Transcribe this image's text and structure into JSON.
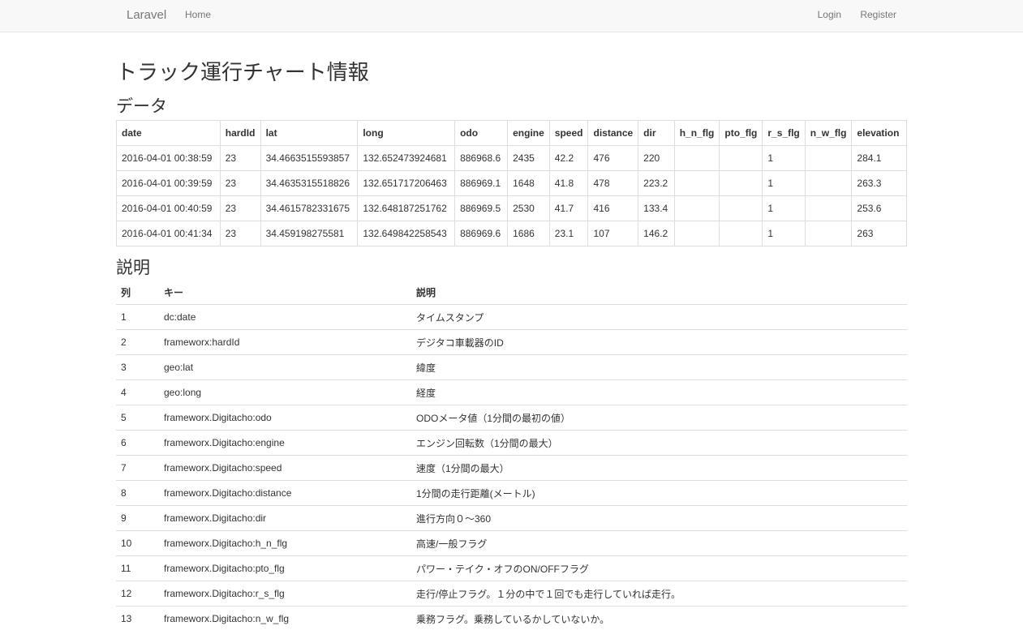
{
  "nav": {
    "brand": "Laravel",
    "home": "Home",
    "login": "Login",
    "register": "Register"
  },
  "page": {
    "title": "トラック運行チャート情報",
    "data_heading": "データ",
    "desc_heading": "説明"
  },
  "data_table": {
    "columns": [
      "date",
      "hardId",
      "lat",
      "long",
      "odo",
      "engine",
      "speed",
      "distance",
      "dir",
      "h_n_flg",
      "pto_flg",
      "r_s_flg",
      "n_w_flg",
      "elevation"
    ],
    "rows": [
      [
        "2016-04-01 00:38:59",
        "23",
        "34.4663515593857",
        "132.652473924681",
        "886968.6",
        "2435",
        "42.2",
        "476",
        "220",
        "",
        "",
        "1",
        "",
        "284.1"
      ],
      [
        "2016-04-01 00:39:59",
        "23",
        "34.4635315518826",
        "132.651717206463",
        "886969.1",
        "1648",
        "41.8",
        "478",
        "223.2",
        "",
        "",
        "1",
        "",
        "263.3"
      ],
      [
        "2016-04-01 00:40:59",
        "23",
        "34.4615782331675",
        "132.648187251762",
        "886969.5",
        "2530",
        "41.7",
        "416",
        "133.4",
        "",
        "",
        "1",
        "",
        "253.6"
      ],
      [
        "2016-04-01 00:41:34",
        "23",
        "34.459198275581",
        "132.649842258543",
        "886969.6",
        "1686",
        "23.1",
        "107",
        "146.2",
        "",
        "",
        "1",
        "",
        "263"
      ]
    ]
  },
  "desc_table": {
    "columns": [
      "列",
      "キー",
      "説明"
    ],
    "rows": [
      [
        "1",
        "dc:date",
        "タイムスタンプ"
      ],
      [
        "2",
        "frameworx:hardId",
        "デジタコ車載器のID"
      ],
      [
        "3",
        "geo:lat",
        "緯度"
      ],
      [
        "4",
        "geo:long",
        "経度"
      ],
      [
        "5",
        "frameworx.Digitacho:odo",
        "ODOメータ値（1分間の最初の値）"
      ],
      [
        "6",
        "frameworx.Digitacho:engine",
        "エンジン回転数（1分間の最大）"
      ],
      [
        "7",
        "frameworx.Digitacho:speed",
        "速度（1分間の最大）"
      ],
      [
        "8",
        "frameworx.Digitacho:distance",
        "1分間の走行距離(メートル)"
      ],
      [
        "9",
        "frameworx.Digitacho:dir",
        "進行方向０〜360"
      ],
      [
        "10",
        "frameworx.Digitacho:h_n_flg",
        "高速/一般フラグ"
      ],
      [
        "11",
        "frameworx.Digitacho:pto_flg",
        "パワー・テイク・オフのON/OFFフラグ"
      ],
      [
        "12",
        "frameworx.Digitacho:r_s_flg",
        "走行/停止フラグ。１分の中で１回でも走行していれば走行。"
      ],
      [
        "13",
        "frameworx.Digitacho:n_w_flg",
        "乗務フラグ。乗務しているかしていないか。"
      ]
    ]
  }
}
